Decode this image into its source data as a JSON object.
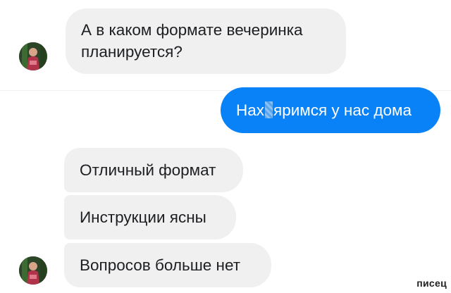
{
  "chat": {
    "messages": [
      {
        "sender": "contact",
        "text": "А в каком формате вечеринка планируется?",
        "lines": [
          "А в каком формате вечеринка",
          "планируется?"
        ]
      },
      {
        "sender": "me",
        "text_before": "Нах",
        "text_after": "яримся у нас дома"
      },
      {
        "sender": "contact",
        "text": "Отличный формат"
      },
      {
        "sender": "contact",
        "text": "Инструкции ясны"
      },
      {
        "sender": "contact",
        "text": "Вопросов больше нет"
      }
    ]
  },
  "watermark": "писец",
  "colors": {
    "incoming_bubble": "#f0f0f0",
    "outgoing_bubble": "#0a82f7",
    "incoming_text": "#1c1e21",
    "outgoing_text": "#ffffff"
  }
}
